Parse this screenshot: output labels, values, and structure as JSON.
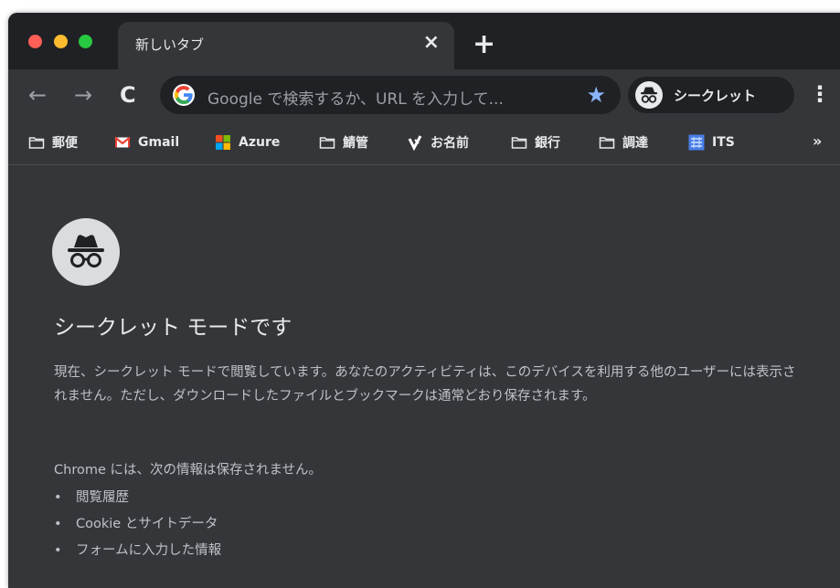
{
  "tab": {
    "title": "新しいタブ",
    "close": "×",
    "new_tab": "+"
  },
  "toolbar": {
    "back": "←",
    "forward": "→",
    "reload": "C",
    "omnibox_placeholder": "Google で検索するか、URL を入力して...",
    "star": "★",
    "incognito_label": "シークレット",
    "menu": "⋮"
  },
  "bookmarks": {
    "items": [
      {
        "label": "郵便",
        "icon": "folder-icon"
      },
      {
        "label": "Gmail",
        "icon": "gmail-icon"
      },
      {
        "label": "Azure",
        "icon": "microsoft-icon"
      },
      {
        "label": "鯖管",
        "icon": "folder-icon"
      },
      {
        "label": "お名前",
        "icon": "onamae-icon"
      },
      {
        "label": "銀行",
        "icon": "folder-icon"
      },
      {
        "label": "調達",
        "icon": "folder-icon"
      },
      {
        "label": "ITS",
        "icon": "its-icon"
      }
    ],
    "more": "»"
  },
  "main": {
    "title": "シークレット モードです",
    "paragraph": "現在、シークレット モードで閲覧しています。あなたのアクティビティは、このデバイスを利用する他のユーザーには表示されません。ただし、ダウンロードしたファイルとブックマークは通常どおり保存されます。",
    "not_saved_heading": "Chrome には、次の情報は保存されません。",
    "not_saved_items": [
      "閲覧履歴",
      "Cookie とサイトデータ",
      "フォームに入力した情報"
    ]
  },
  "colors": {
    "frame": "#202124",
    "toolbar": "#35363a",
    "text": "#e8eaed",
    "secondary_text": "#bdc1c6",
    "star": "#8ab4f8"
  }
}
